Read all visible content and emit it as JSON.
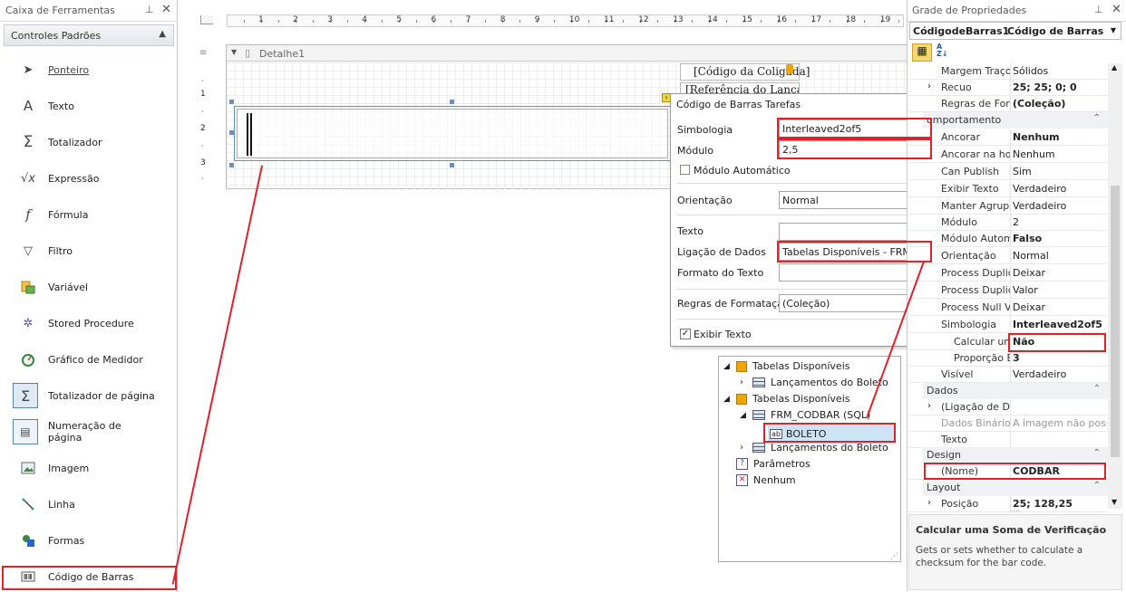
{
  "toolbox": {
    "title": "Caixa de Ferramentas",
    "group": "Controles Padrões",
    "items": [
      {
        "label": "Ponteiro",
        "icon": "pointer-icon"
      },
      {
        "label": "Texto",
        "icon": "text-icon"
      },
      {
        "label": "Totalizador",
        "icon": "sum-icon"
      },
      {
        "label": "Expressão",
        "icon": "expression-icon"
      },
      {
        "label": "Fórmula",
        "icon": "formula-icon"
      },
      {
        "label": "Filtro",
        "icon": "filter-icon"
      },
      {
        "label": "Variável",
        "icon": "variable-icon"
      },
      {
        "label": "Stored Procedure",
        "icon": "stored-procedure-icon"
      },
      {
        "label": "Gráfico de Medidor",
        "icon": "gauge-icon"
      },
      {
        "label": "Totalizador de página",
        "icon": "page-sum-icon"
      },
      {
        "label": "Numeração de página",
        "icon": "page-number-icon"
      },
      {
        "label": "Imagem",
        "icon": "image-icon"
      },
      {
        "label": "Linha",
        "icon": "line-icon"
      },
      {
        "label": "Formas",
        "icon": "shapes-icon"
      },
      {
        "label": "Código de Barras",
        "icon": "barcode-icon"
      }
    ]
  },
  "designer": {
    "ruler": [
      "1",
      "2",
      "3",
      "4",
      "5",
      "6",
      "7",
      "8",
      "9",
      "10",
      "11",
      "12",
      "13",
      "14",
      "15",
      "16",
      "17",
      "18",
      "19"
    ],
    "vruler": [
      "1",
      "2",
      "3"
    ],
    "band": "Detalhe1",
    "field1": "[Código da Coligada]",
    "field2": "[Referência do Lança"
  },
  "tasks": {
    "title": "Código de Barras Tarefas",
    "simbologia_label": "Simbologia",
    "simbologia_value": "Interleaved2of5",
    "modulo_label": "Módulo",
    "modulo_value": "2,5",
    "modulo_auto_label": "Módulo Automático",
    "orientacao_label": "Orientação",
    "orientacao_value": "Normal",
    "texto_label": "Texto",
    "texto_value": "",
    "ligacao_label": "Ligação de Dados",
    "ligacao_value": "Tabelas Disponíveis - FRM_CO",
    "formato_label": "Formato do Texto",
    "regras_label": "Regras de Formatação",
    "regras_value": "(Coleção)",
    "exibir_label": "Exibir Texto",
    "ellipsis": "..."
  },
  "datatree": [
    {
      "label": "Tabelas Disponíveis"
    },
    {
      "label": "Lançamentos do Boleto"
    },
    {
      "label": "Tabelas Disponíveis"
    },
    {
      "label": "FRM_CODBAR (SQL)"
    },
    {
      "label": "BOLETO"
    },
    {
      "label": "Lançamentos do Boleto"
    },
    {
      "label": "Parâmetros"
    },
    {
      "label": "Nenhum"
    }
  ],
  "properties": {
    "title": "Grade de Propriedades",
    "object_name": "CódigodeBarras1",
    "object_type": "Código de Barras",
    "rows": [
      {
        "name": "Margem Traço B",
        "value": "Sólidos"
      },
      {
        "name": "Recuo",
        "value": "25; 25; 0; 0"
      },
      {
        "name": "Regras de Form",
        "value": "(Coleção)"
      },
      {
        "name": "Ancorar",
        "value": "Nenhum"
      },
      {
        "name": "Ancorar na hori",
        "value": "Nenhum"
      },
      {
        "name": "Can Publish",
        "value": "Sim"
      },
      {
        "name": "Exibir Texto",
        "value": "Verdadeiro"
      },
      {
        "name": "Manter Agrupad",
        "value": "Verdadeiro"
      },
      {
        "name": "Módulo",
        "value": "2"
      },
      {
        "name": "Módulo Automá",
        "value": "Falso"
      },
      {
        "name": "Orientação",
        "value": "Normal"
      },
      {
        "name": "Process Duplica",
        "value": "Deixar"
      },
      {
        "name": "Process Duplica",
        "value": "Valor"
      },
      {
        "name": "Process Null Val",
        "value": "Deixar"
      },
      {
        "name": "Simbologia",
        "value": "Interleaved2of5"
      },
      {
        "name": "Calcular uma",
        "value": "Não"
      },
      {
        "name": "Proporção E",
        "value": "3"
      },
      {
        "name": "Visível",
        "value": "Verdadeiro"
      },
      {
        "name": "(Ligação de Dac",
        "value": ""
      },
      {
        "name": "Dados Binários",
        "value": "A imagem não poss..."
      },
      {
        "name": "Texto",
        "value": ""
      },
      {
        "name": "(Nome)",
        "value": "CODBAR"
      },
      {
        "name": "Posição",
        "value": "25; 128,25"
      }
    ],
    "cat_comportamento": "omportamento",
    "cat_dados": "Dados",
    "cat_design": "Design",
    "cat_layout": "Layout",
    "desc_title": "Calcular uma Soma de Verificação",
    "desc_text": "Gets or sets whether to calculate a checksum for the bar code."
  },
  "colors": {
    "highlight": "#e0202a",
    "accent": "#2b579a"
  }
}
